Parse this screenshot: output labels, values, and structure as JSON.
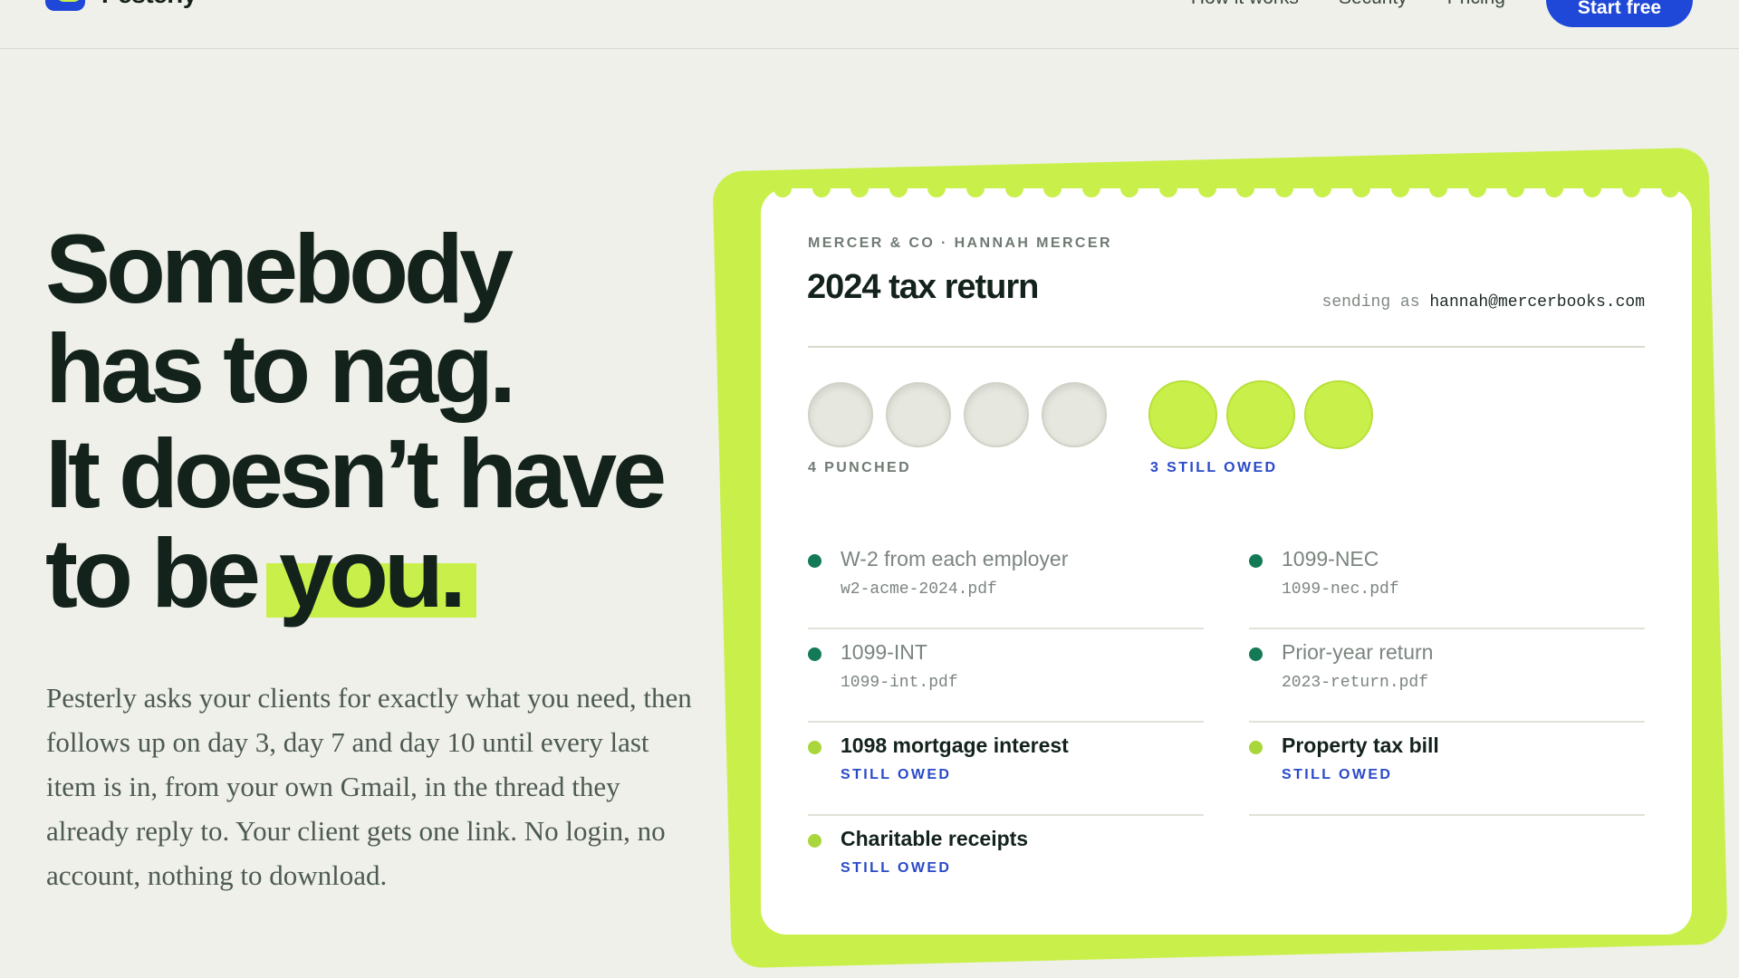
{
  "nav": {
    "brand": "Pesterly",
    "links": [
      "How it works",
      "Security",
      "Pricing"
    ],
    "cta": "Start free"
  },
  "hero": {
    "line1": "Somebody",
    "line2": "has to nag.",
    "line3": "It doesn’t have",
    "line4_prefix": "to be ",
    "line4_highlight": "you.",
    "lede": "Pesterly asks your clients for exactly what you need, then follows up on day 3, day 7 and day 10 until every last item is in, from your own Gmail, in the thread they already reply to. Your client gets one link. No login, no account, nothing to download."
  },
  "card": {
    "eyebrow": "MERCER & CO · HANNAH MERCER",
    "title": "2024 tax return",
    "sender_prefix": "sending as",
    "sender_email": "hannah@mercerbooks.com",
    "punched": 4,
    "owed": 3,
    "punched_label": "4 PUNCHED",
    "owed_label": "3 STILL OWED",
    "items": [
      {
        "name": "W-2 from each employer",
        "file": "w2-acme-2024.pdf",
        "status": "received"
      },
      {
        "name": "1099-NEC",
        "file": "1099-nec.pdf",
        "status": "received"
      },
      {
        "name": "1099-INT",
        "file": "1099-int.pdf",
        "status": "received"
      },
      {
        "name": "Prior-year return",
        "file": "2023-return.pdf",
        "status": "received"
      },
      {
        "name": "1098 mortgage interest",
        "file": "",
        "status": "STILL OWED"
      },
      {
        "name": "Property tax bill",
        "file": "",
        "status": "STILL OWED"
      },
      {
        "name": "Charitable receipts",
        "file": "",
        "status": "STILL OWED"
      }
    ]
  },
  "colors": {
    "accent_lime": "#c9f04a",
    "accent_blue": "#1f47d8",
    "received_green": "#137a55",
    "ink": "#13231c",
    "background": "#eef0e9"
  }
}
